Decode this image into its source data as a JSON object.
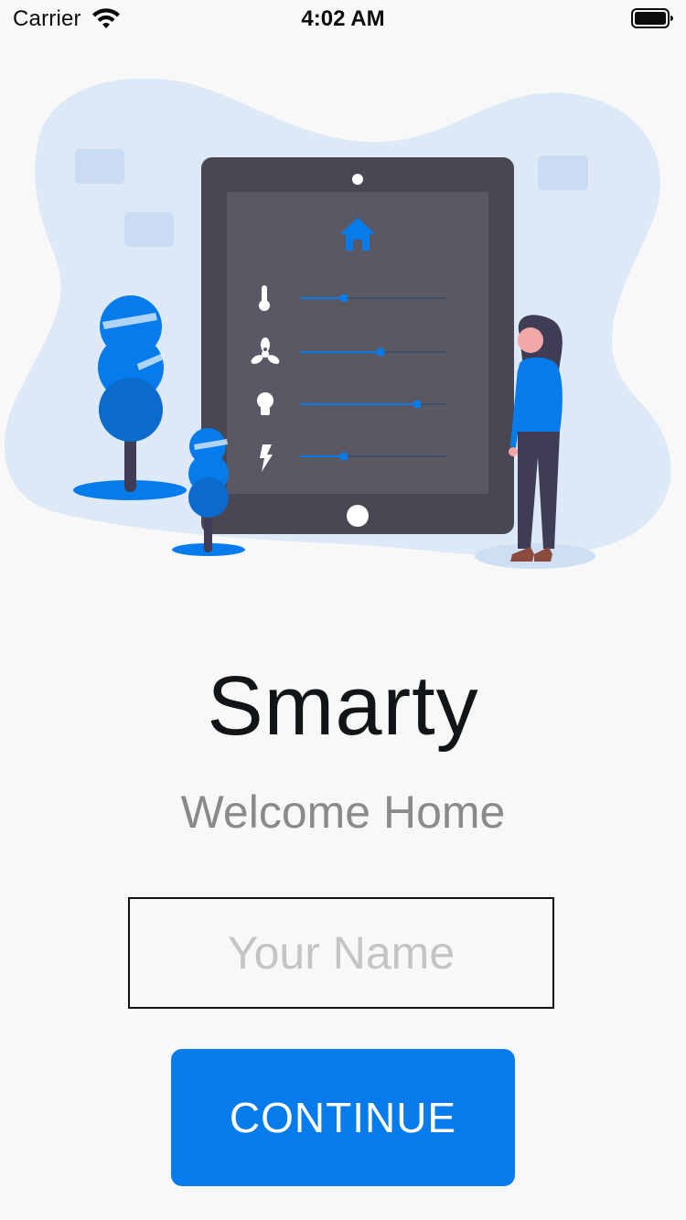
{
  "status_bar": {
    "carrier": "Carrier",
    "time": "4:02 AM"
  },
  "hero": {
    "title": "Smarty",
    "subtitle": "Welcome Home"
  },
  "form": {
    "name_placeholder": "Your Name",
    "name_value": "",
    "continue_label": "CONTINUE"
  },
  "illustration": {
    "sliders": [
      {
        "icon": "thermometer-icon",
        "level": 0.3
      },
      {
        "icon": "fan-icon",
        "level": 0.55
      },
      {
        "icon": "lightbulb-icon",
        "level": 0.8
      },
      {
        "icon": "lightning-icon",
        "level": 0.3
      }
    ]
  },
  "colors": {
    "accent": "#067cec",
    "background": "#f7f8f7",
    "title": "#111518",
    "subtitle": "#8a8a8a",
    "placeholder": "#c4c4c4",
    "tablet": "#4a4754",
    "blob": "#dde9f6"
  }
}
